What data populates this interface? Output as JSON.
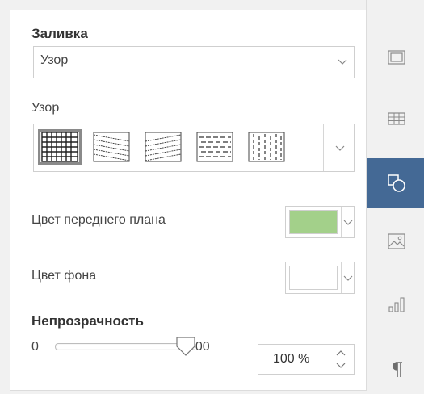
{
  "fill": {
    "heading": "Заливка",
    "type_value": "Узор"
  },
  "pattern": {
    "label": "Узор",
    "options": [
      "grid",
      "diagonal-down",
      "diagonal-up",
      "dashed-horizontal",
      "dashed-vertical"
    ],
    "selected_index": 0
  },
  "foreground": {
    "label": "Цвет переднего плана",
    "color": "#a3d08a"
  },
  "background": {
    "label": "Цвет фона",
    "color": "#ffffff"
  },
  "opacity": {
    "heading": "Непрозрачность",
    "min_label": "0",
    "max_label": "100",
    "value": 100,
    "value_text": "100 %"
  },
  "sidebar": {
    "items": [
      {
        "name": "slide-settings-icon",
        "active": false
      },
      {
        "name": "table-settings-icon",
        "active": false
      },
      {
        "name": "shape-settings-icon",
        "active": true
      },
      {
        "name": "image-settings-icon",
        "active": false
      },
      {
        "name": "chart-settings-icon",
        "active": false
      },
      {
        "name": "paragraph-settings-icon",
        "active": false
      }
    ],
    "accent": "#446995"
  }
}
